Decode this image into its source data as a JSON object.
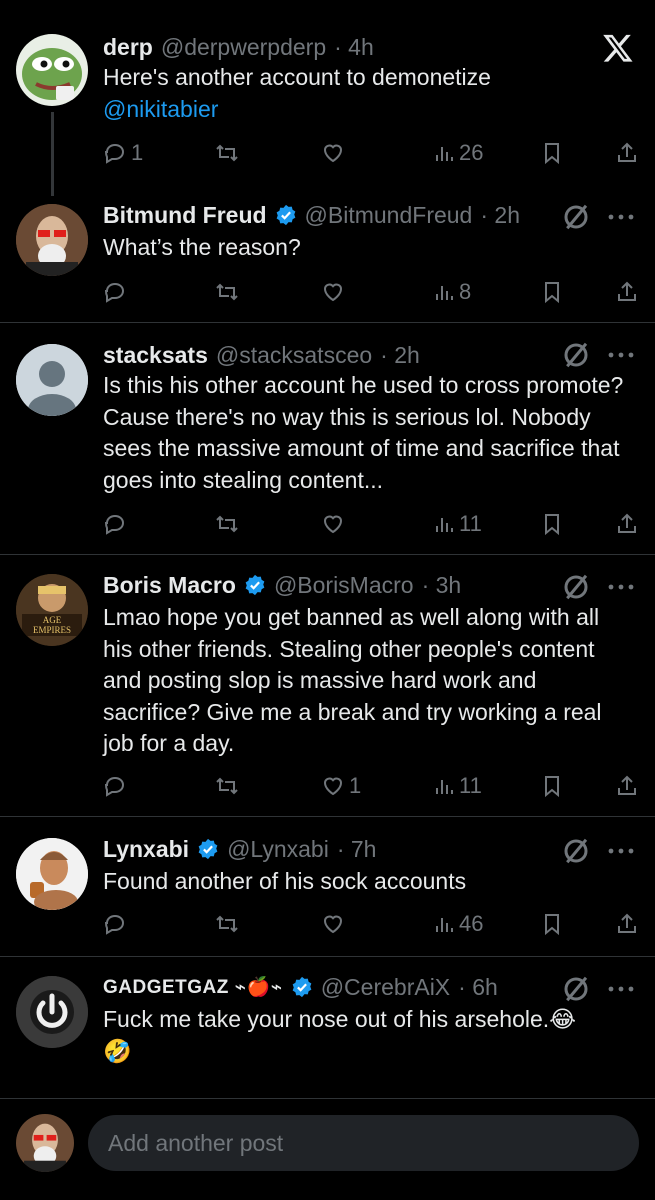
{
  "brand": {
    "logo_icon": "x-logo-icon",
    "accent": "#1d9bf0",
    "muted": "#71767b",
    "verified_color": "#1d9bf0"
  },
  "posts": [
    {
      "name": "derp",
      "handle": "@derpwerpderp",
      "time": "· 4h",
      "text": "Here's another account to demonetize",
      "mention": "@nikitabier",
      "actions": {
        "reply": "1",
        "repost": "",
        "like": "",
        "views": "26"
      }
    },
    {
      "name": "Bitmund Freud",
      "handle": "@BitmundFreud",
      "time": "· 2h",
      "text": "What’s the reason?",
      "actions": {
        "reply": "",
        "repost": "",
        "like": "",
        "views": "8"
      }
    },
    {
      "name": "stacksats",
      "handle": "@stacksatsceo",
      "time": "· 2h",
      "text": "Is this his other account he used to cross promote? Cause there's no way this is serious lol. Nobody sees the massive amount of time and sacrifice that goes into stealing content...",
      "actions": {
        "reply": "",
        "repost": "",
        "like": "",
        "views": "11"
      }
    },
    {
      "name": "Boris Macro",
      "handle": "@BorisMacro",
      "time": "· 3h",
      "avatar_text": "AGE EMPIRES",
      "text": "Lmao hope you get banned as well along with all his other friends. Stealing other people's content and posting slop is massive hard work and sacrifice? Give me a break and try working a real job for a day.",
      "actions": {
        "reply": "",
        "repost": "",
        "like": "1",
        "views": "11"
      }
    },
    {
      "name": "Lynxabi",
      "handle": "@Lynxabi",
      "time": "· 7h",
      "text": "Found another of his sock accounts",
      "actions": {
        "reply": "",
        "repost": "",
        "like": "",
        "views": "46"
      }
    },
    {
      "name": "GADGETGAZ ⌁🍎⌁",
      "handle": "@CerebrAiX",
      "time": "· 6h",
      "text": "Fuck me take your nose out of his arsehole.😂",
      "text2": "🤣"
    }
  ],
  "composer": {
    "placeholder": "Add another post"
  }
}
